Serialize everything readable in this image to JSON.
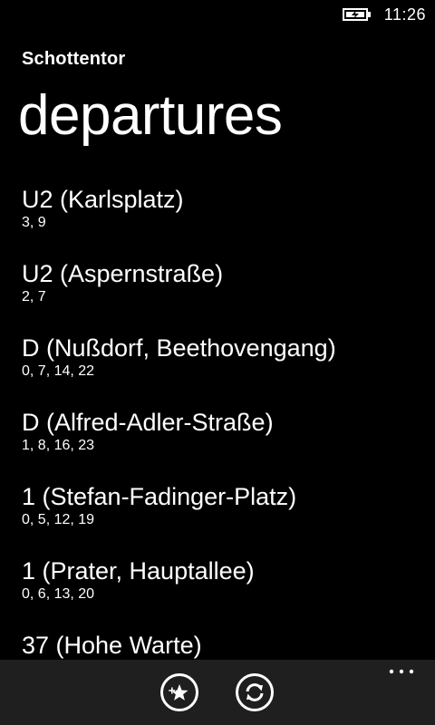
{
  "status": {
    "time": "11:26",
    "battery_icon": "battery-charging-icon"
  },
  "header": {
    "app_title": "Schottentor",
    "page_title": "departures"
  },
  "departures": [
    {
      "line": "U2 (Karlsplatz)",
      "times": "3, 9"
    },
    {
      "line": "U2 (Aspernstraße)",
      "times": "2, 7"
    },
    {
      "line": "D (Nußdorf, Beethovengang)",
      "times": "0, 7, 14, 22"
    },
    {
      "line": "D (Alfred-Adler-Straße)",
      "times": "1, 8, 16, 23"
    },
    {
      "line": "1 (Stefan-Fadinger-Platz)",
      "times": "0, 5, 12, 19"
    },
    {
      "line": "1 (Prater, Hauptallee)",
      "times": "0, 6, 13, 20"
    },
    {
      "line": "37 (Hohe Warte)",
      "times": ""
    }
  ],
  "app_bar": {
    "buttons": [
      {
        "icon": "pin-to-start-icon"
      },
      {
        "icon": "refresh-icon"
      }
    ],
    "more_icon": "ellipsis-icon",
    "background": "#1f1f1f"
  }
}
